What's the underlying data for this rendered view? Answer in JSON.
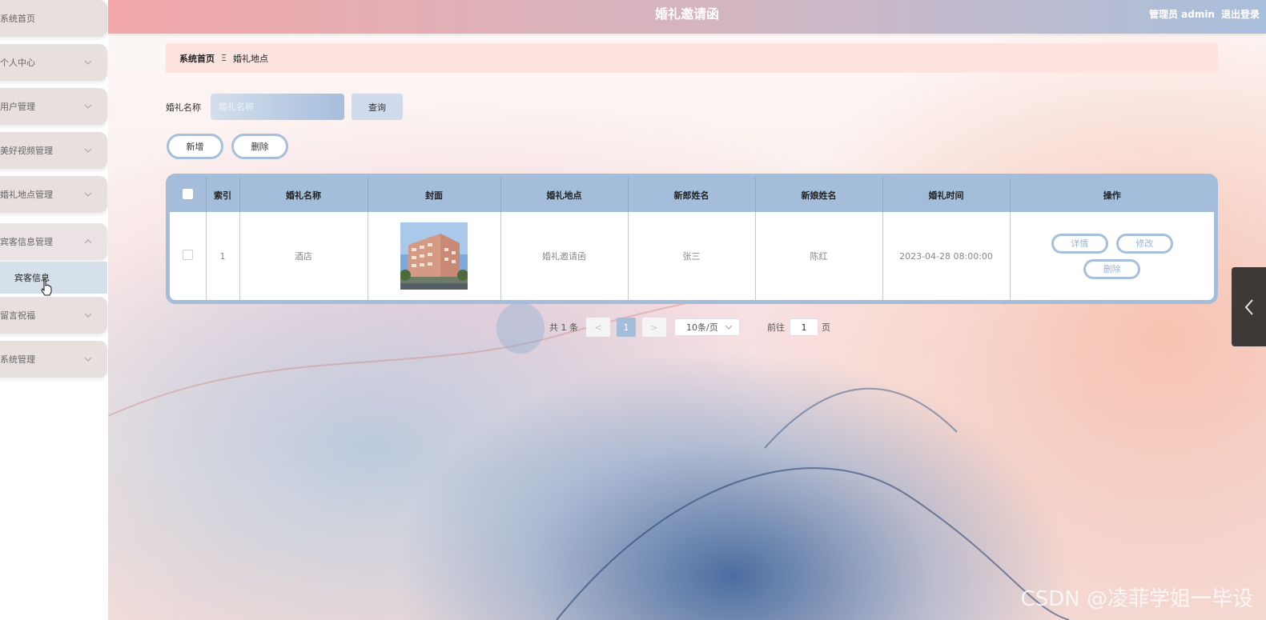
{
  "header": {
    "title": "婚礼邀请函",
    "user_label": "管理员 admin",
    "logout_label": "退出登录"
  },
  "sidebar": {
    "items": [
      {
        "label": "系统首页"
      },
      {
        "label": "个人中心"
      },
      {
        "label": "用户管理"
      },
      {
        "label": "美好视频管理"
      },
      {
        "label": "婚礼地点管理"
      },
      {
        "label": "宾客信息管理"
      },
      {
        "label": "留言祝福"
      },
      {
        "label": "系统管理"
      }
    ],
    "submenu": {
      "label": "宾客信息"
    }
  },
  "breadcrumb": {
    "home": "系统首页",
    "separator": "Ξ",
    "current": "婚礼地点"
  },
  "search": {
    "label": "婚礼名称",
    "placeholder": "婚礼名称",
    "button": "查询"
  },
  "actions": {
    "add": "新增",
    "delete": "删除"
  },
  "table": {
    "headers": [
      "索引",
      "婚礼名称",
      "封面",
      "婚礼地点",
      "新郎姓名",
      "新娘姓名",
      "婚礼时间",
      "操作"
    ],
    "rows": [
      {
        "index": "1",
        "name": "酒店",
        "location": "婚礼邀请函",
        "groom": "张三",
        "bride": "陈红",
        "time": "2023-04-28 08:00:00",
        "ops": {
          "detail": "详情",
          "edit": "修改",
          "delete": "删除"
        }
      }
    ]
  },
  "pagination": {
    "total": "共 1 条",
    "prev": "<",
    "current": "1",
    "next": ">",
    "page_size": "10条/页",
    "goto_label": "前往",
    "goto_value": "1",
    "page_suffix": "页"
  },
  "watermark": "CSDN @凌菲学姐一毕设"
}
